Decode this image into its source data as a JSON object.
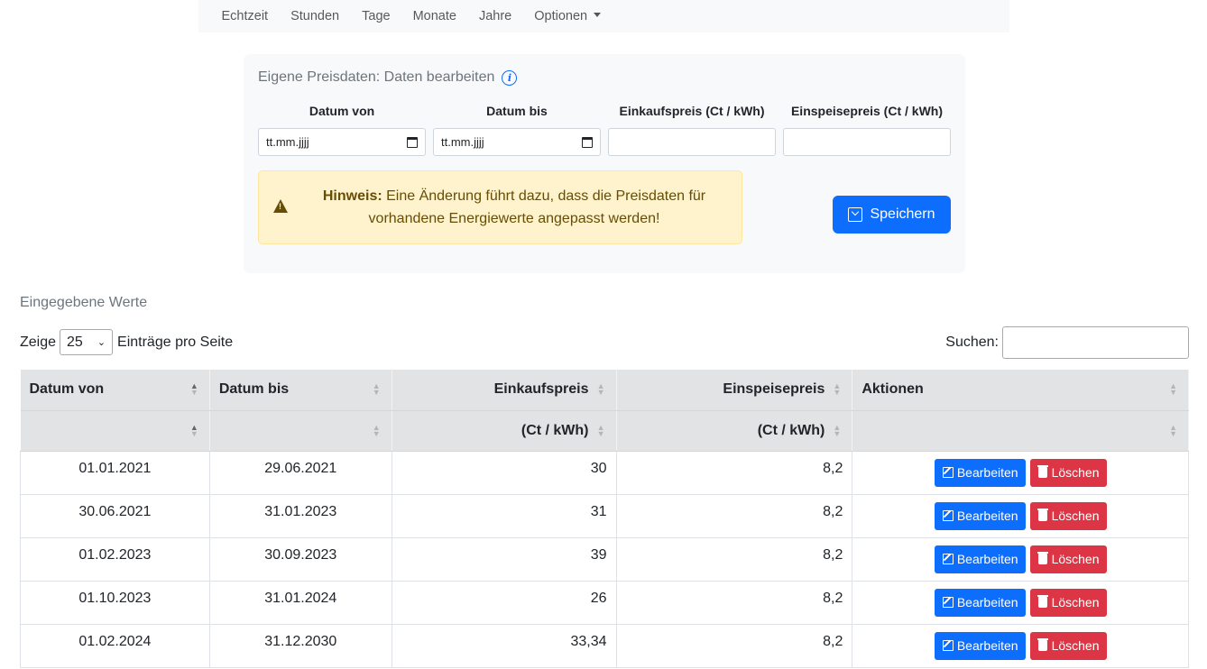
{
  "nav": {
    "items": [
      "Echtzeit",
      "Stunden",
      "Tage",
      "Monate",
      "Jahre"
    ],
    "dropdown_label": "Optionen"
  },
  "form": {
    "title": "Eigene Preisdaten: Daten bearbeiten",
    "info_icon": "info-circle-icon",
    "fields": [
      {
        "label": "Datum von",
        "value": "tt.mm.jjjj"
      },
      {
        "label": "Datum bis",
        "value": "tt.mm.jjjj"
      },
      {
        "label": "Einkaufspreis (Ct / kWh)",
        "value": ""
      },
      {
        "label": "Einspeisepreis (Ct / kWh)",
        "value": ""
      }
    ],
    "alert": {
      "strong": "Hinweis:",
      "line1": " Eine Änderung führt dazu, dass die Preisdaten für",
      "line2": "vorhandene Energiewerte angepasst werden!"
    },
    "save_label": "Speichern"
  },
  "list": {
    "section_label": "Eingegebene Werte",
    "show_prefix": "Zeige",
    "page_length": "25",
    "show_suffix": "Einträge pro Seite",
    "search_label": "Suchen:",
    "search_value": "",
    "headers": {
      "row1": [
        "Datum von",
        "Datum bis",
        "Einkaufspreis",
        "Einspeisepreis",
        "Aktionen"
      ],
      "row2": [
        "",
        "",
        "(Ct / kWh)",
        "(Ct / kWh)",
        ""
      ]
    },
    "edit_label": "Bearbeiten",
    "delete_label": "Löschen",
    "rows": [
      {
        "von": "01.01.2021",
        "bis": "29.06.2021",
        "einkauf": "30",
        "einspeise": "8,2"
      },
      {
        "von": "30.06.2021",
        "bis": "31.01.2023",
        "einkauf": "31",
        "einspeise": "8,2"
      },
      {
        "von": "01.02.2023",
        "bis": "30.09.2023",
        "einkauf": "39",
        "einspeise": "8,2"
      },
      {
        "von": "01.10.2023",
        "bis": "31.01.2024",
        "einkauf": "26",
        "einspeise": "8,2"
      },
      {
        "von": "01.02.2024",
        "bis": "31.12.2030",
        "einkauf": "33,34",
        "einspeise": "8,2"
      }
    ]
  },
  "colors": {
    "primary": "#0d6efd",
    "danger": "#dc3545",
    "warning_bg": "#fff3cd",
    "warning_text": "#664d03"
  }
}
